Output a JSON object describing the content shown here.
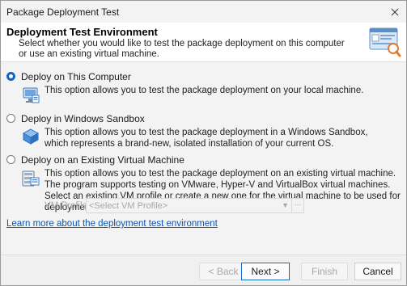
{
  "window": {
    "title": "Package Deployment Test",
    "close_icon": "close-icon"
  },
  "header": {
    "title": "Deployment Test Environment",
    "description": "Select whether you would like to test the package deployment on this computer or use an existing virtual machine.",
    "icon": "deployment-environment-icon"
  },
  "options": [
    {
      "label": "Deploy on This Computer",
      "selected": true,
      "icon": "computer-icon",
      "description": "This option allows you to test the package deployment on your local machine."
    },
    {
      "label": "Deploy in Windows Sandbox",
      "selected": false,
      "icon": "sandbox-icon",
      "description": "This option allows you to test the package deployment in a Windows Sandbox, which represents a brand-new, isolated installation of your current OS."
    },
    {
      "label": "Deploy on an Existing Virtual Machine",
      "selected": false,
      "icon": "virtual-machine-icon",
      "description": "This option allows you to test the package deployment on an existing virtual machine. The program supports testing on VMware, Hyper-V and VirtualBox virtual machines. Select an existing VM profile or create a new one for the virtual machine to be used for deployment testing."
    }
  ],
  "vm_profile": {
    "label": "VM Profile:",
    "value": "<Select VM Profile>",
    "ellipsis": "...",
    "enabled": false
  },
  "learn_more": "Learn more about the deployment test environment",
  "buttons": {
    "back": "< Back",
    "next": "Next >",
    "finish": "Finish",
    "cancel": "Cancel"
  },
  "colors": {
    "accent": "#1565c0",
    "link": "#0a56b6",
    "disabled_text": "#a8a8a8"
  }
}
